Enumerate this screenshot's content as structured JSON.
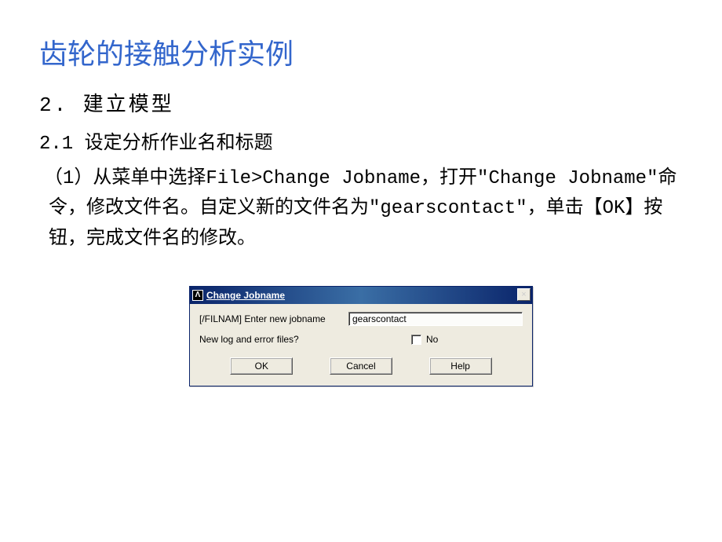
{
  "slide": {
    "title": "齿轮的接触分析实例",
    "heading2": "2. 建立模型",
    "heading3": "2.1 设定分析作业名和标题",
    "paragraph": "（1）从菜单中选择File>Change Jobname，打开\"Change Jobname\"命令，修改文件名。自定义新的文件名为\"gearscontact\"，单击【OK】按钮，完成文件名的修改。"
  },
  "dialog": {
    "icon_letter": "Λ",
    "title": "Change Jobname",
    "close_symbol": "×",
    "row1_label": "[/FILNAM] Enter new jobname",
    "row1_value": "gearscontact",
    "row2_label": "New log and error files?",
    "row2_checkbox_label": "No",
    "buttons": {
      "ok": "OK",
      "cancel": "Cancel",
      "help": "Help"
    }
  }
}
